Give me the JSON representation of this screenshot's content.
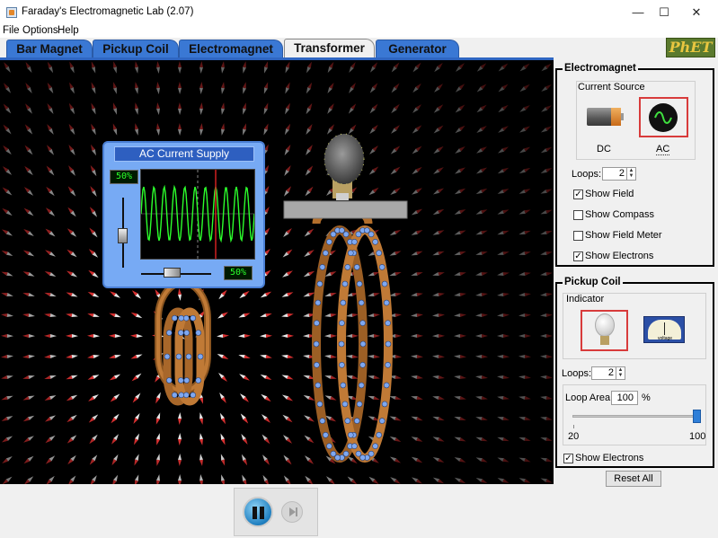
{
  "window": {
    "title": "Faraday's Electromagnetic Lab (2.07)",
    "minimize": "—",
    "maximize": "☐",
    "close": "✕"
  },
  "menu": {
    "items": [
      "File",
      "Options",
      "Help"
    ]
  },
  "tabs": [
    {
      "label": "Bar Magnet",
      "active": false
    },
    {
      "label": "Pickup Coil",
      "active": false
    },
    {
      "label": "Electromagnet",
      "active": false
    },
    {
      "label": "Transformer",
      "active": true
    },
    {
      "label": "Generator",
      "active": false
    }
  ],
  "logo": {
    "text": "PhET"
  },
  "ac_supply": {
    "title": "AC Current Supply",
    "amplitude": "50%",
    "frequency": "50%"
  },
  "electromagnet_panel": {
    "title": "Electromagnet",
    "current_source": {
      "label": "Current Source",
      "options": [
        "DC",
        "AC"
      ],
      "selected": "AC"
    },
    "loops_label": "Loops:",
    "loops_value": "2",
    "checkboxes": [
      {
        "label": "Show Field",
        "checked": true
      },
      {
        "label": "Show Compass",
        "checked": false
      },
      {
        "label": "Show Field Meter",
        "checked": false
      },
      {
        "label": "Show Electrons",
        "checked": true
      }
    ]
  },
  "pickup_coil_panel": {
    "title": "Pickup Coil",
    "indicator": {
      "label": "Indicator",
      "options": [
        "lightbulb",
        "voltmeter"
      ],
      "selected": "lightbulb",
      "voltmeter_text": "voltage"
    },
    "loops_label": "Loops:",
    "loops_value": "2",
    "loop_area": {
      "label": "Loop Area:",
      "value": "100",
      "unit": "%",
      "min_label": "20",
      "max_label": "100",
      "level": 1.0
    },
    "show_electrons": {
      "label": "Show Electrons",
      "checked": true
    }
  },
  "reset_button": "Reset All",
  "colors": {
    "tab_blue": "#3a78d4",
    "canvas": "#000000",
    "ac_box": "#77aaf4",
    "coil": "#b8742e",
    "selection": "#d83b3b",
    "trace": "#2cff2c"
  },
  "icons": [
    "battery-icon",
    "ac-source-icon",
    "lightbulb-icon",
    "voltmeter-icon",
    "pause-icon",
    "step-icon"
  ]
}
